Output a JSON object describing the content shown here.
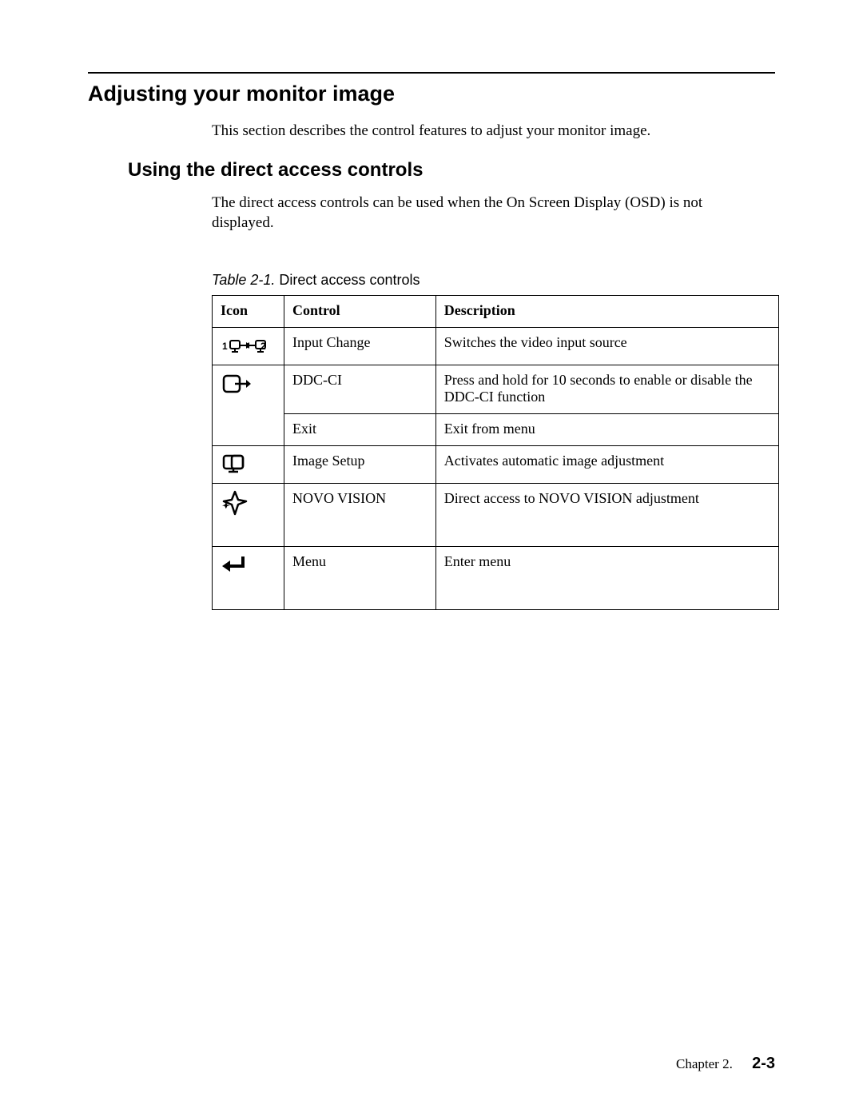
{
  "heading1": "Adjusting your monitor image",
  "para1": "This section describes the control features to adjust your monitor image.",
  "heading2": "Using the direct access controls",
  "para2": "The direct access controls can be used when the On Screen Display (OSD) is not displayed.",
  "table_caption_label": "Table 2-1.",
  "table_caption_text": "Direct access controls",
  "table": {
    "headers": {
      "icon": "Icon",
      "control": "Control",
      "description": "Description"
    },
    "rows": [
      {
        "icon_name": "input-change-icon",
        "control": "Input Change",
        "description": "Switches the video input source"
      },
      {
        "icon_name": "exit-icon",
        "control": "DDC-CI",
        "description": "Press and hold for 10 seconds to enable or disable the DDC-CI function"
      },
      {
        "icon_name": "",
        "control": "Exit",
        "description": "Exit from menu"
      },
      {
        "icon_name": "image-setup-icon",
        "control": "Image Setup",
        "description": "Activates automatic image adjustment"
      },
      {
        "icon_name": "novo-vision-icon",
        "control": "NOVO VISION",
        "description": "Direct access to NOVO VISION adjustment"
      },
      {
        "icon_name": "menu-enter-icon",
        "control": "Menu",
        "description": "Enter menu"
      }
    ]
  },
  "footer": {
    "chapter_label": "Chapter 2.",
    "page_number": "2-3"
  }
}
